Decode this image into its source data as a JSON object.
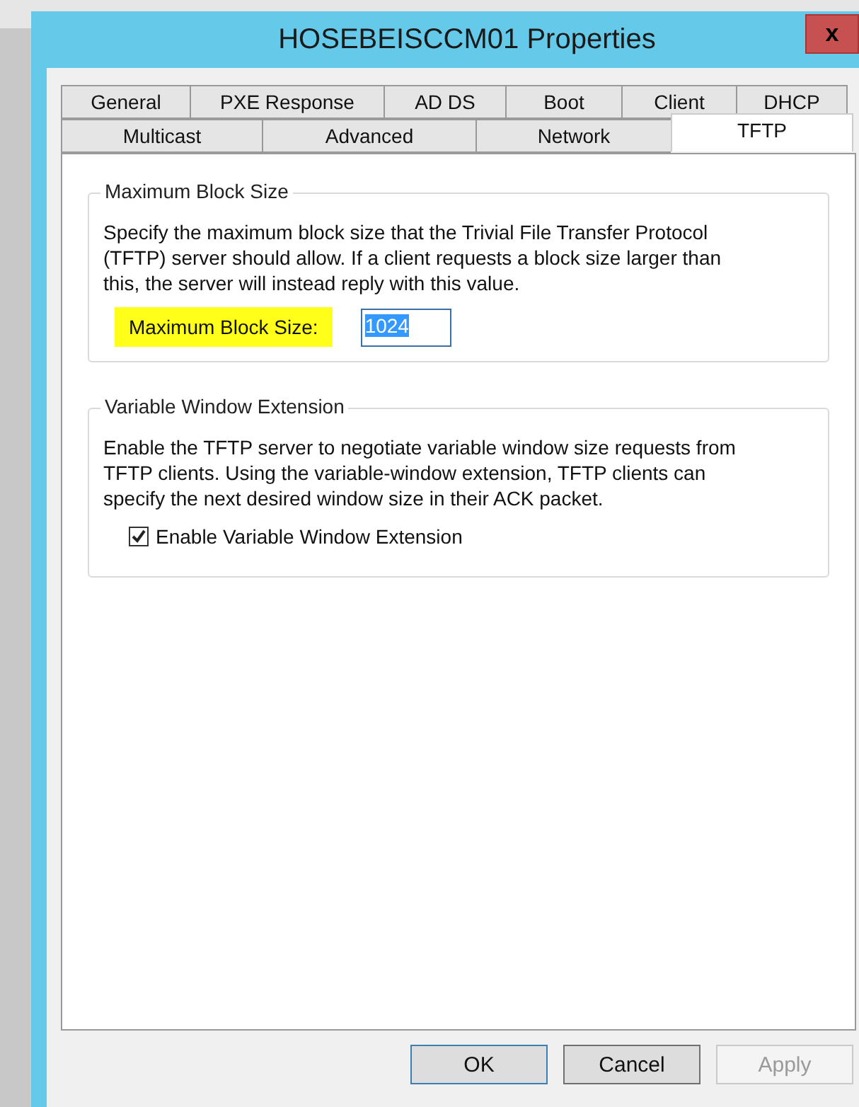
{
  "window": {
    "title": "HOSEBEISCCM01 Properties",
    "close": "x"
  },
  "tab_rows": [
    {
      "tabs": [
        {
          "label": "General",
          "selected": false
        },
        {
          "label": "PXE Response",
          "selected": false
        },
        {
          "label": "AD DS",
          "selected": false
        },
        {
          "label": "Boot",
          "selected": false
        },
        {
          "label": "Client",
          "selected": false
        },
        {
          "label": "DHCP",
          "selected": false
        }
      ]
    },
    {
      "tabs": [
        {
          "label": "Multicast",
          "selected": false
        },
        {
          "label": "Advanced",
          "selected": false
        },
        {
          "label": "Network",
          "selected": false
        },
        {
          "label": "TFTP",
          "selected": true
        }
      ]
    }
  ],
  "groups": [
    {
      "kind": "field",
      "title": "Maximum Block Size",
      "description": "Specify the maximum block size that the Trivial File Transfer Protocol (TFTP) server should allow. If a client requests a block size larger than this, the server will instead reply with this value.",
      "label": "Maximum Block Size:",
      "highlighted": true,
      "value": "1024"
    },
    {
      "kind": "checkbox",
      "title": "Variable Window Extension",
      "description": "Enable the TFTP server to negotiate variable window size requests from TFTP clients. Using the variable-window extension, TFTP clients can specify the next desired window size in their ACK packet.",
      "label": "Enable Variable Window Extension",
      "checked": true
    }
  ],
  "buttons": [
    {
      "label": "OK",
      "disabled": false,
      "default": true
    },
    {
      "label": "Cancel",
      "disabled": false,
      "default": false
    },
    {
      "label": "Apply",
      "disabled": true,
      "default": false
    }
  ]
}
